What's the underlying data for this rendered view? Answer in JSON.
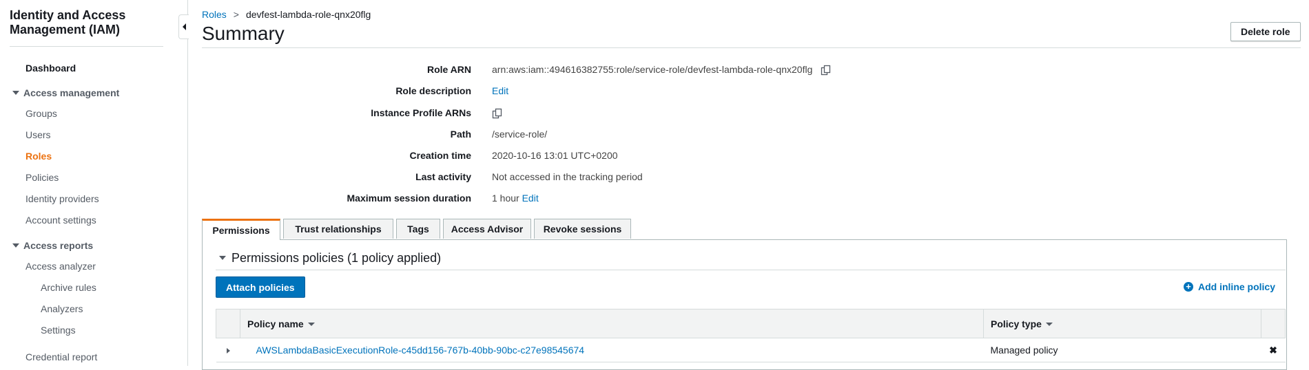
{
  "sidebar": {
    "title": "Identity and Access Management (IAM)",
    "dashboard": "Dashboard",
    "access_management": {
      "label": "Access management",
      "items": [
        "Groups",
        "Users",
        "Roles",
        "Policies",
        "Identity providers",
        "Account settings"
      ],
      "active": "Roles"
    },
    "access_reports": {
      "label": "Access reports",
      "access_analyzer": "Access analyzer",
      "sub_items": [
        "Archive rules",
        "Analyzers",
        "Settings"
      ],
      "credential_report": "Credential report"
    }
  },
  "breadcrumb": {
    "root": "Roles",
    "separator": ">",
    "current": "devfest-lambda-role-qnx20flg"
  },
  "page": {
    "title": "Summary",
    "delete_button": "Delete role"
  },
  "summary": {
    "role_arn_label": "Role ARN",
    "role_arn_value": "arn:aws:iam::494616382755:role/service-role/devfest-lambda-role-qnx20flg",
    "role_description_label": "Role description",
    "role_description_edit": "Edit",
    "instance_profile_label": "Instance Profile ARNs",
    "path_label": "Path",
    "path_value": "/service-role/",
    "creation_time_label": "Creation time",
    "creation_time_value": "2020-10-16 13:01 UTC+0200",
    "last_activity_label": "Last activity",
    "last_activity_value": "Not accessed in the tracking period",
    "max_session_label": "Maximum session duration",
    "max_session_value": "1 hour",
    "max_session_edit": "Edit"
  },
  "tabs": [
    "Permissions",
    "Trust relationships",
    "Tags",
    "Access Advisor",
    "Revoke sessions"
  ],
  "permissions": {
    "heading": "Permissions policies (1 policy applied)",
    "attach_button": "Attach policies",
    "add_inline": "Add inline policy",
    "columns": [
      "Policy name",
      "Policy type"
    ],
    "rows": [
      {
        "name": "AWSLambdaBasicExecutionRole-c45dd156-767b-40bb-90bc-c27e98545674",
        "type": "Managed policy"
      }
    ]
  },
  "colors": {
    "link": "#0073bb",
    "active_accent": "#ec7211",
    "primary_button": "#0073bb"
  }
}
